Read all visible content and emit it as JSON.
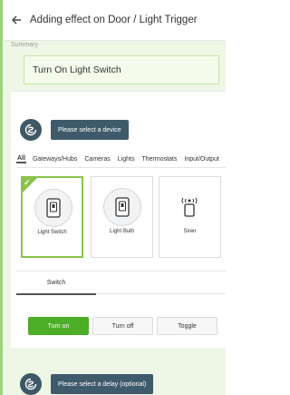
{
  "header": {
    "title": "Adding effect on Door / Light Trigger",
    "back_icon": "arrow-left-icon"
  },
  "summary": {
    "label": "Summary",
    "value": "Turn On Light Switch"
  },
  "device_step": {
    "icon": "smartthings-icon",
    "button_label": "Please select a device"
  },
  "tabs": [
    "All",
    "Gateways/Hubs",
    "Cameras",
    "Lights",
    "Thermostats",
    "Input/Output"
  ],
  "active_tab": "All",
  "devices": [
    {
      "label": "Light Switch",
      "icon": "switch-icon",
      "selected": true
    },
    {
      "label": "Light Bulb",
      "icon": "switch-icon",
      "selected": false
    },
    {
      "label": "Siren",
      "icon": "siren-icon",
      "selected": false
    }
  ],
  "switch_section": {
    "tab_label": "Switch",
    "actions": [
      "Turn on",
      "Turn off",
      "Toggle"
    ],
    "active_action": "Turn on"
  },
  "delay_step": {
    "icon": "smartthings-icon",
    "button_label": "Please select a delay (optional)"
  },
  "colors": {
    "accent_green": "#4cad27",
    "selected_border": "#8bc34a",
    "step_button": "#3f5b6b"
  }
}
